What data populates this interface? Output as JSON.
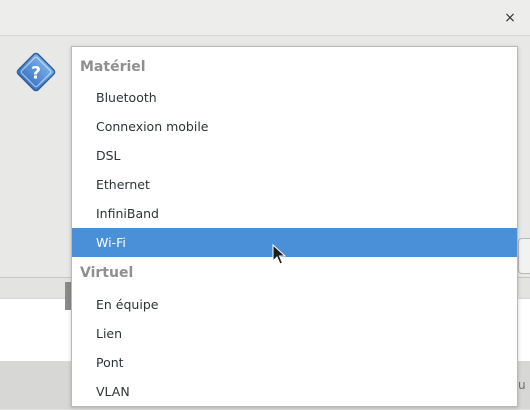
{
  "window": {
    "close_glyph": "×"
  },
  "dialog": {
    "icon": "question-icon",
    "peek_text": "u"
  },
  "dropdown": {
    "sections": [
      {
        "header": "Matériel",
        "items": [
          "Bluetooth",
          "Connexion mobile",
          "DSL",
          "Ethernet",
          "InfiniBand",
          "Wi-Fi"
        ]
      },
      {
        "header": "Virtuel",
        "items": [
          "En équipe",
          "Lien",
          "Pont",
          "VLAN"
        ]
      }
    ],
    "selected": "Wi-Fi",
    "highlight_color": "#4a90d9"
  }
}
